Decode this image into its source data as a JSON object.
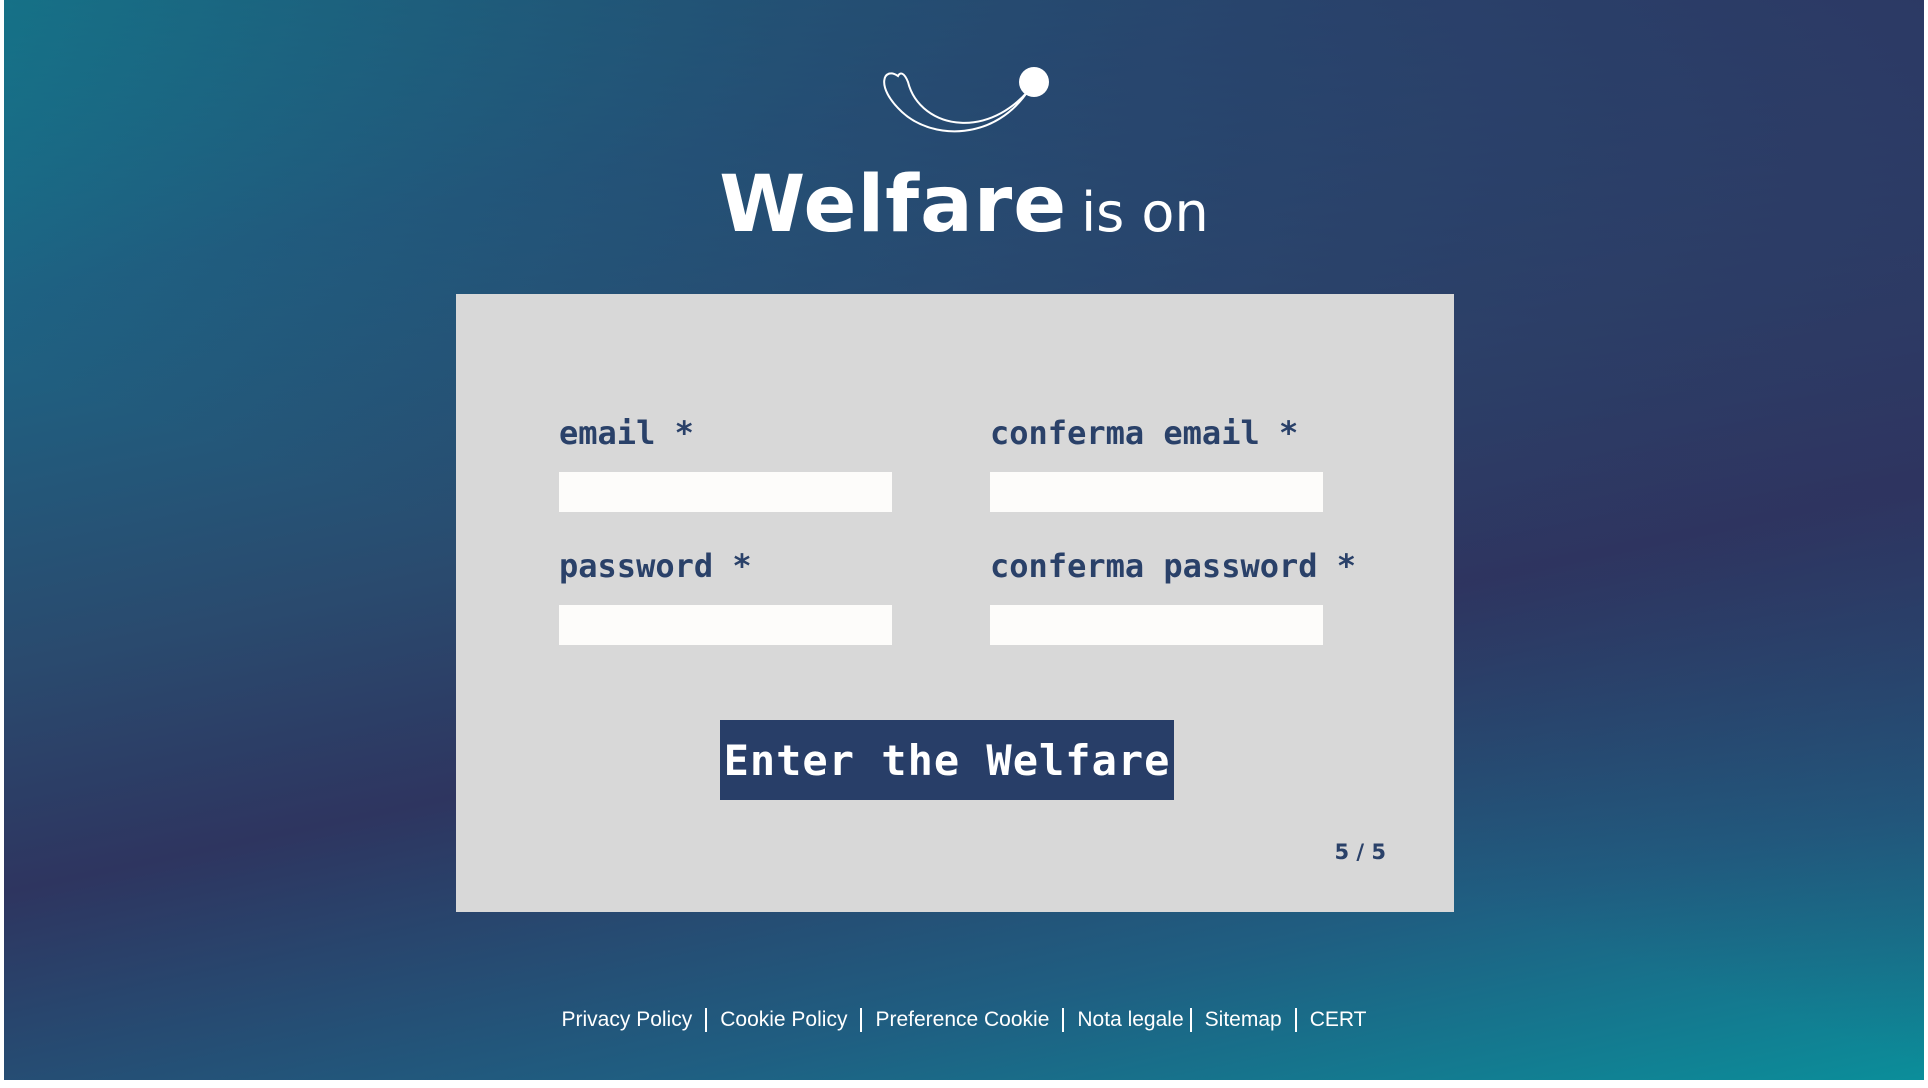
{
  "brand": {
    "name": "Welfare",
    "tagline": "is on",
    "logo_icon": "smile-logo-icon"
  },
  "form": {
    "fields": [
      {
        "label": "email *",
        "value": "",
        "placeholder": ""
      },
      {
        "label": "conferma email *",
        "value": "",
        "placeholder": ""
      },
      {
        "label": "password *",
        "value": "",
        "placeholder": ""
      },
      {
        "label": "conferma password *",
        "value": "",
        "placeholder": ""
      }
    ],
    "submit_label": "Enter the Welfare",
    "step": "5 / 5"
  },
  "footer": {
    "links": [
      "Privacy Policy",
      "Cookie Policy",
      "Preference Cookie",
      "Nota legale",
      "Sitemap",
      "CERT"
    ]
  },
  "colors": {
    "gradient_teal": "#0a8f9a",
    "gradient_indigo": "#2e3560",
    "card_background": "#d8d8d8",
    "accent_navy": "#283e68",
    "input_background": "#fdfcfa"
  }
}
